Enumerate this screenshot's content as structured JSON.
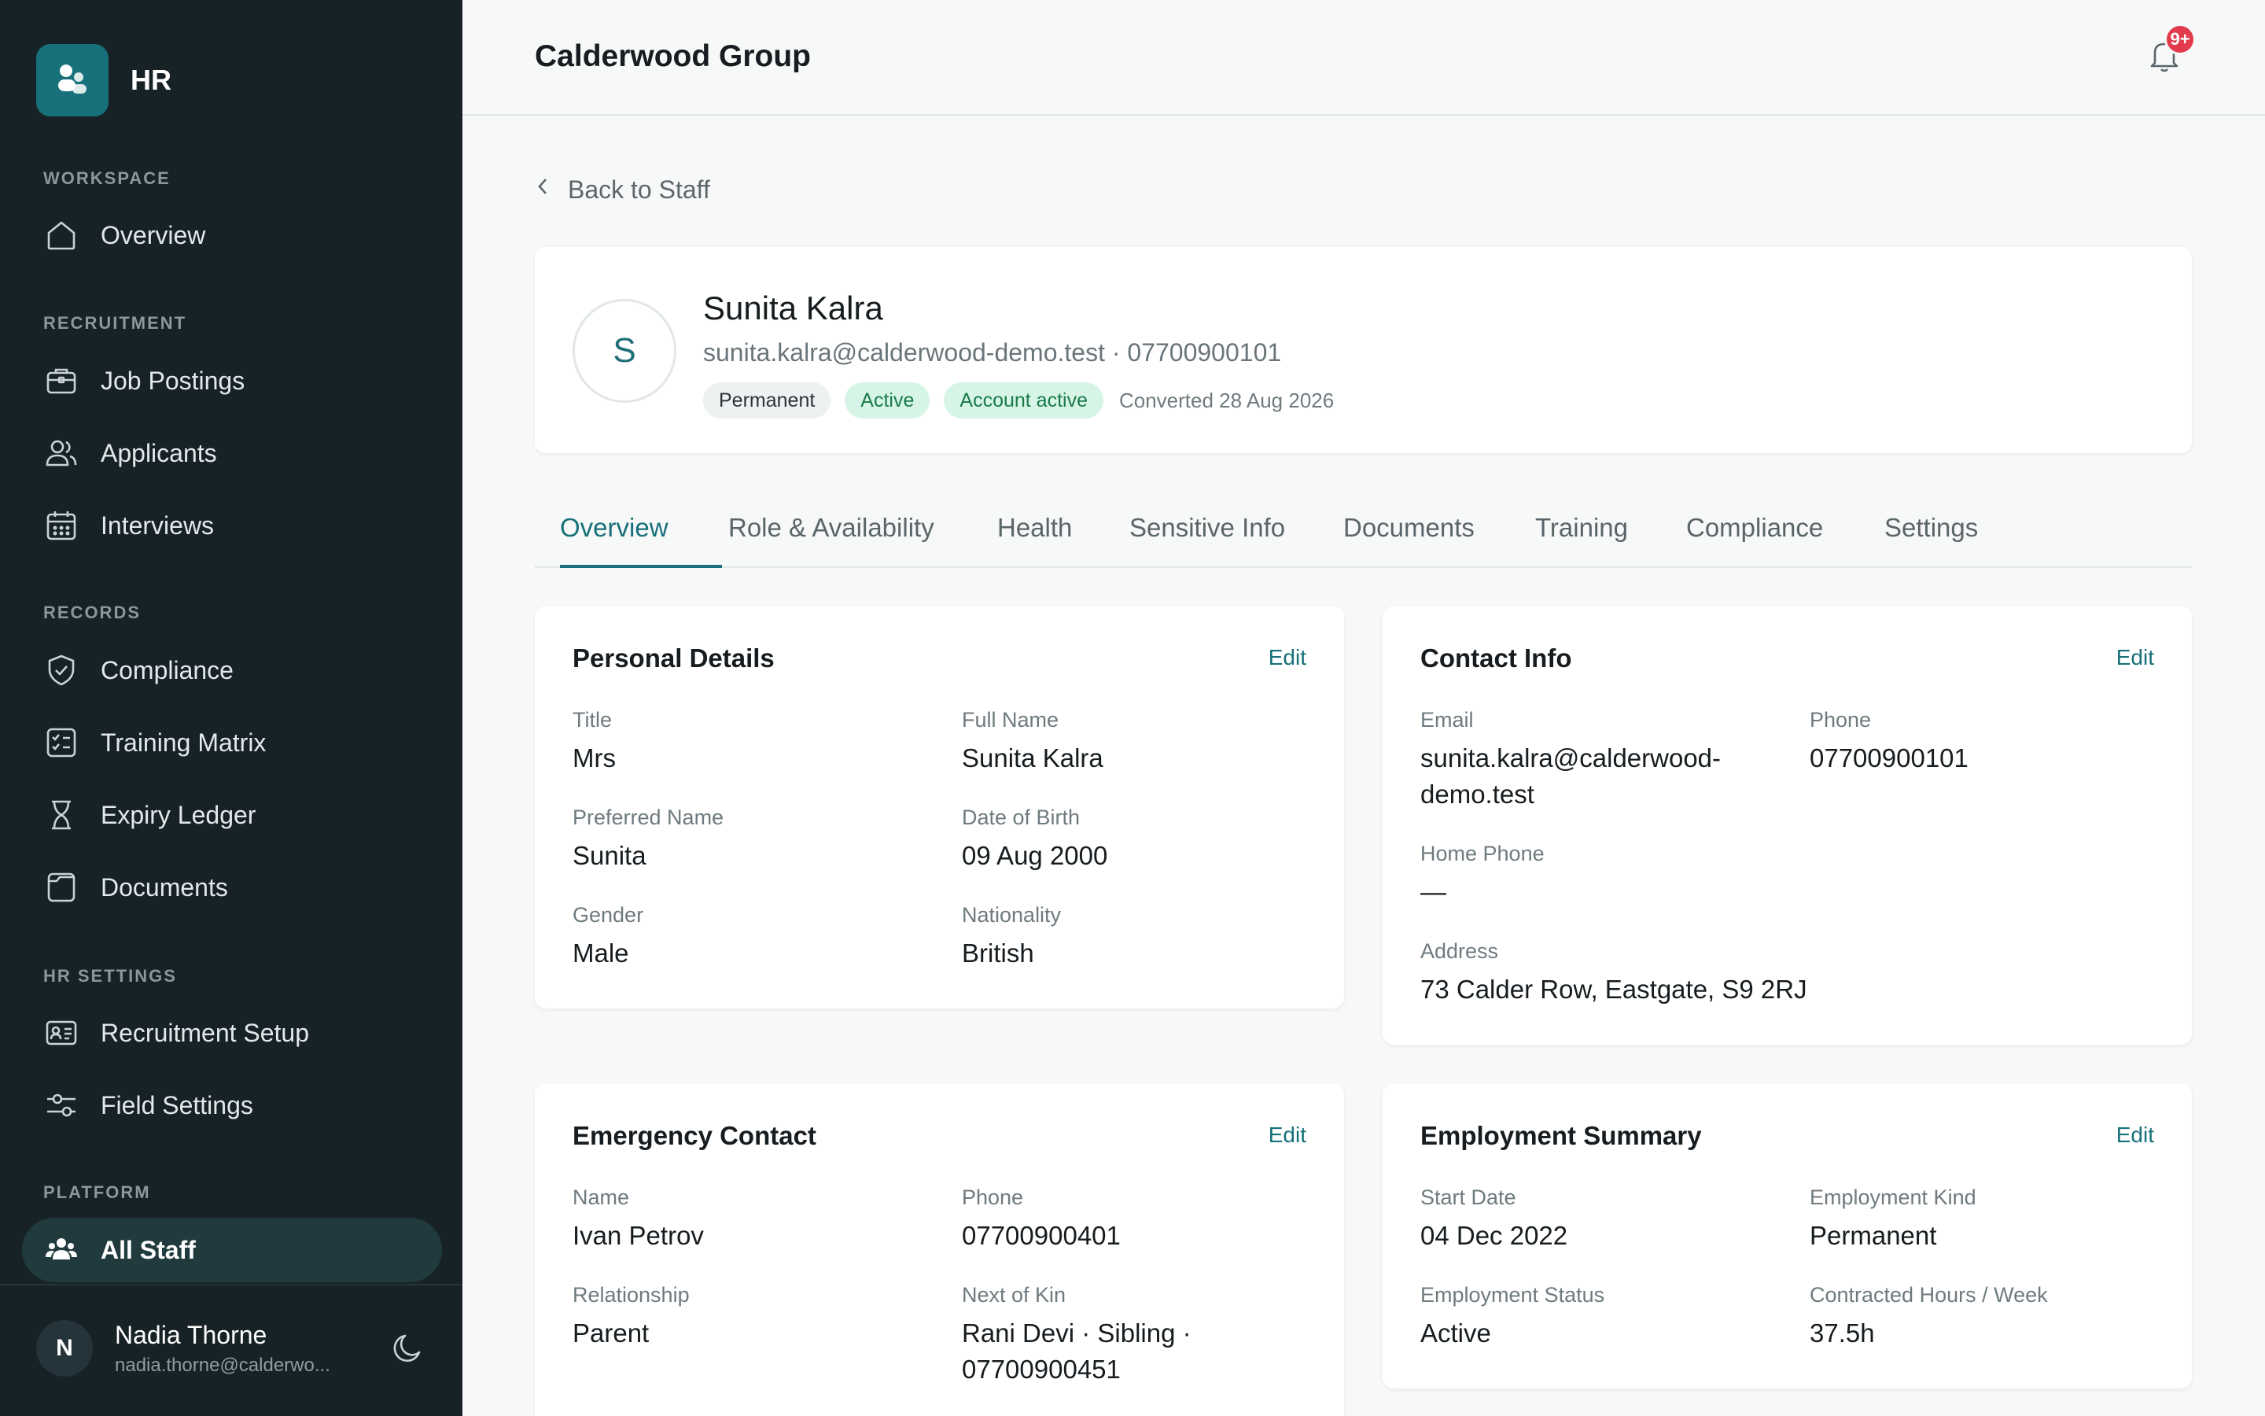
{
  "sidebar": {
    "brand": "HR",
    "sections": {
      "workspace": "WORKSPACE",
      "recruitment": "RECRUITMENT",
      "records": "RECORDS",
      "hr_settings": "HR SETTINGS",
      "platform": "PLATFORM"
    },
    "items": {
      "overview": "Overview",
      "job_postings": "Job Postings",
      "applicants": "Applicants",
      "interviews": "Interviews",
      "compliance": "Compliance",
      "training_matrix": "Training Matrix",
      "expiry_ledger": "Expiry Ledger",
      "documents": "Documents",
      "recruitment_setup": "Recruitment Setup",
      "field_settings": "Field Settings",
      "all_staff": "All Staff"
    },
    "user": {
      "initial": "N",
      "name": "Nadia Thorne",
      "email": "nadia.thorne@calderwo..."
    }
  },
  "header": {
    "org_name": "Calderwood Group",
    "notification_count": "9+"
  },
  "back_link": "Back to Staff",
  "profile": {
    "initial": "S",
    "name": "Sunita Kalra",
    "meta": "sunita.kalra@calderwood-demo.test · 07700900101",
    "badges": {
      "employment": "Permanent",
      "status": "Active",
      "account": "Account active"
    },
    "converted": "Converted 28 Aug 2026"
  },
  "tabs": {
    "overview": "Overview",
    "role": "Role & Availability",
    "health": "Health",
    "sensitive": "Sensitive Info",
    "documents": "Documents",
    "training": "Training",
    "compliance": "Compliance",
    "settings": "Settings"
  },
  "edit_label": "Edit",
  "personal": {
    "title": "Personal Details",
    "fields": {
      "title": {
        "label": "Title",
        "value": "Mrs"
      },
      "full_name": {
        "label": "Full Name",
        "value": "Sunita Kalra"
      },
      "preferred": {
        "label": "Preferred Name",
        "value": "Sunita"
      },
      "dob": {
        "label": "Date of Birth",
        "value": "09 Aug 2000"
      },
      "gender": {
        "label": "Gender",
        "value": "Male"
      },
      "nationality": {
        "label": "Nationality",
        "value": "British"
      }
    }
  },
  "contact": {
    "title": "Contact Info",
    "fields": {
      "email": {
        "label": "Email",
        "value": "sunita.kalra@calderwood-demo.test"
      },
      "phone": {
        "label": "Phone",
        "value": "07700900101"
      },
      "home_phone": {
        "label": "Home Phone",
        "value": "—"
      },
      "address": {
        "label": "Address",
        "value": "73 Calder Row, Eastgate, S9 2RJ"
      }
    }
  },
  "emergency": {
    "title": "Emergency Contact",
    "fields": {
      "name": {
        "label": "Name",
        "value": "Ivan Petrov"
      },
      "phone": {
        "label": "Phone",
        "value": "07700900401"
      },
      "relationship": {
        "label": "Relationship",
        "value": "Parent"
      },
      "next_of_kin": {
        "label": "Next of Kin",
        "value": "Rani Devi · Sibling · 07700900451"
      }
    }
  },
  "employment": {
    "title": "Employment Summary",
    "fields": {
      "start_date": {
        "label": "Start Date",
        "value": "04 Dec 2022"
      },
      "kind": {
        "label": "Employment Kind",
        "value": "Permanent"
      },
      "status": {
        "label": "Employment Status",
        "value": "Active"
      },
      "hours": {
        "label": "Contracted Hours / Week",
        "value": "37.5h"
      }
    }
  }
}
